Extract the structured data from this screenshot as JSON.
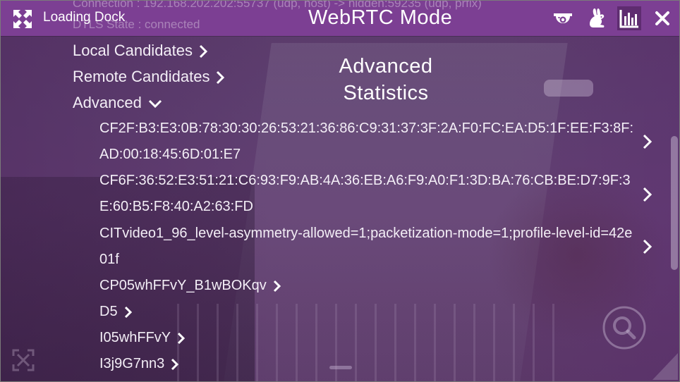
{
  "window": {
    "title": "Loading Dock",
    "mode": "WebRTC Mode",
    "ghost_connection": "Connection : 192.168.202.202:55737 (udp, host) -> hidden:59235 (udp, prflx)",
    "ghost_dtls": "DTLS State : connected"
  },
  "toolbar": {
    "icons": [
      "camera-dome-icon",
      "rabbit-icon",
      "statistics-chart-icon",
      "close-icon"
    ],
    "active": "statistics-chart-icon",
    "accent": "#7c3f93",
    "active_bg": "#5e2c70"
  },
  "stats": {
    "title": "Advanced Statistics",
    "sections": [
      "Local Candidates",
      "Remote Candidates",
      "Advanced"
    ],
    "expanded": "Advanced",
    "entries": [
      "CF2F:B3:E3:0B:78:30:30:26:53:21:36:86:C9:31:37:3F:2A:F0:FC:EA:D5:1F:EE:F3:8F:AD:00:18:45:6D:01:E7",
      "CF6F:36:52:E3:51:21:C6:93:F9:AB:4A:36:EB:A6:F9:A0:F1:3D:BA:76:CB:BE:D7:9F:3E:60:B5:F8:40:A2:63:FD",
      "CITvideo1_96_level-asymmetry-allowed=1;packetization-mode=1;profile-level-id=42e01f"
    ],
    "short_entries": [
      "CP05whFFvY_B1wBOKqv",
      "D5",
      "I05whFFvY",
      "I3j9G7nn3"
    ]
  }
}
